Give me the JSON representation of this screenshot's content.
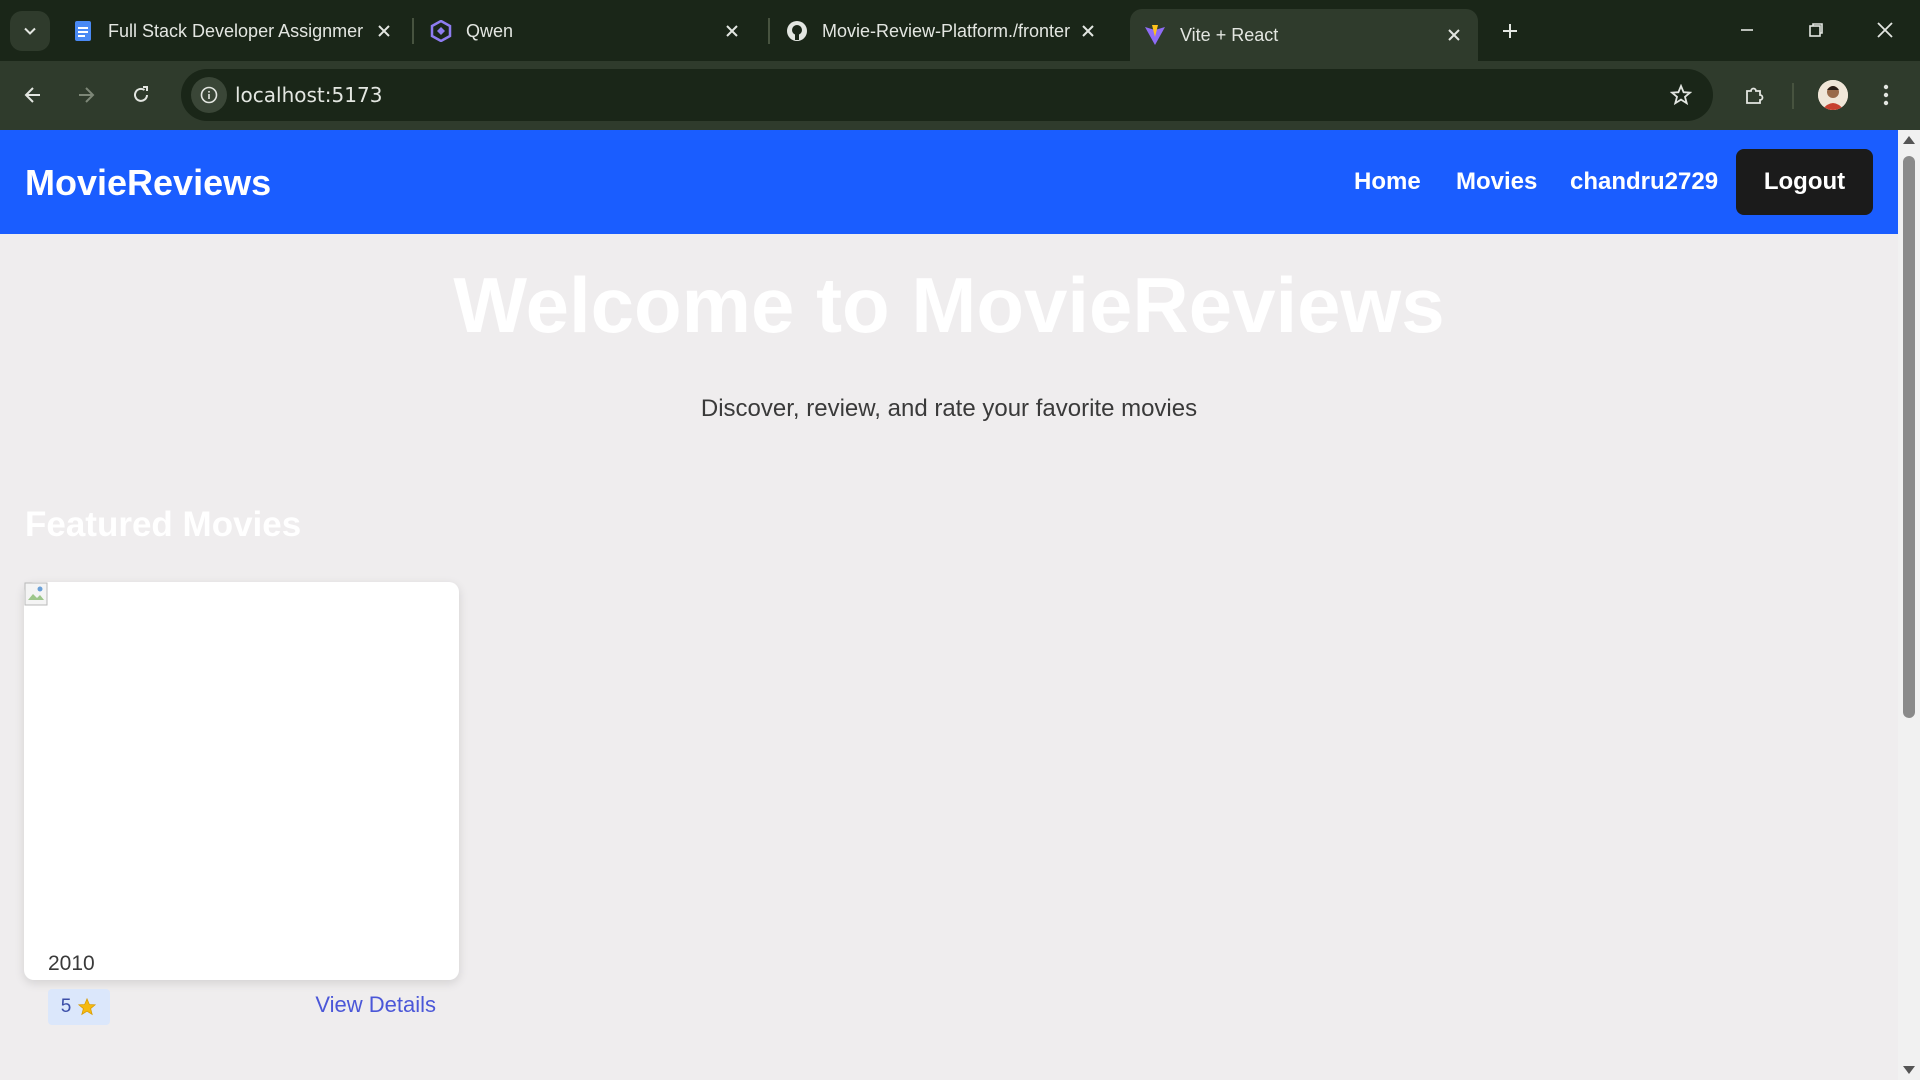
{
  "browser": {
    "tabs": [
      {
        "title": "Full Stack Developer Assignmer",
        "icon": "google-docs-icon",
        "active": false
      },
      {
        "title": "Qwen",
        "icon": "qwen-icon",
        "active": false
      },
      {
        "title": "Movie-Review-Platform./fronter",
        "icon": "github-icon",
        "active": false
      },
      {
        "title": "Vite + React",
        "icon": "vite-icon",
        "active": true
      }
    ],
    "url": "localhost:5173"
  },
  "nav": {
    "brand": "MovieReviews",
    "links": [
      "Home",
      "Movies",
      "chandru2729"
    ],
    "logout": "Logout",
    "color": "#1a5dff"
  },
  "hero": {
    "title": "Welcome to MovieReviews",
    "subtitle": "Discover, review, and rate your favorite movies"
  },
  "featured": {
    "heading": "Featured Movies",
    "movies": [
      {
        "year": "2010",
        "rating": "5",
        "rating_icon": "star-icon",
        "link": "View Details"
      }
    ]
  }
}
